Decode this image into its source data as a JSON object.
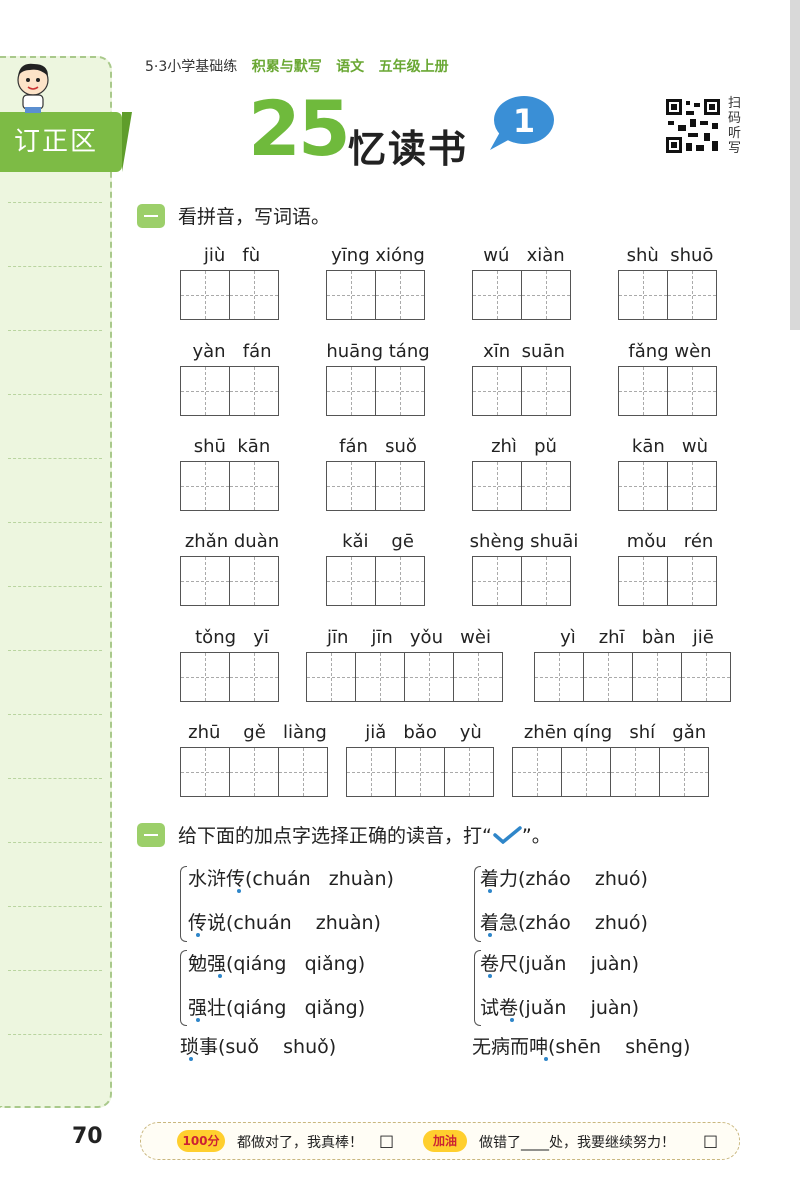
{
  "header": {
    "series": "5·3小学基础练",
    "tag1": "积累与默写",
    "tag2": "语文",
    "tag3": "五年级上册",
    "lesson_number": "25",
    "lesson_title": "忆读书",
    "part_number": "1",
    "qr_label": "扫码听写"
  },
  "sidebar": {
    "title": "订正区"
  },
  "section1": {
    "title": "看拼音，写词语。",
    "groups": [
      {
        "pinyin": "jiù   fù"
      },
      {
        "pinyin": "yīng xióng"
      },
      {
        "pinyin": "wú   xiàn"
      },
      {
        "pinyin": "shù  shuō"
      },
      {
        "pinyin": "yàn   fán"
      },
      {
        "pinyin": "huāng táng"
      },
      {
        "pinyin": "xīn  suān"
      },
      {
        "pinyin": "fǎng wèn"
      },
      {
        "pinyin": "shū  kān"
      },
      {
        "pinyin": "fán   suǒ"
      },
      {
        "pinyin": "zhì   pǔ"
      },
      {
        "pinyin": "kān   wù"
      },
      {
        "pinyin": "zhǎn duàn"
      },
      {
        "pinyin": "kǎi    gē"
      },
      {
        "pinyin": "shèng shuāi"
      },
      {
        "pinyin": "mǒu   rén"
      },
      {
        "pinyin": "tǒng   yī"
      },
      {
        "pinyin": "jīn    jīn   yǒu   wèi"
      },
      {
        "pinyin": "yì    zhī   bàn   jiē"
      },
      {
        "pinyin": "zhū    gě   liàng"
      },
      {
        "pinyin": "jiǎ   bǎo    yù"
      },
      {
        "pinyin": "zhēn qíng   shí   gǎn"
      }
    ]
  },
  "section2": {
    "title": "给下面的加点字选择正确的读音，打“",
    "title_end": "”。",
    "left_items": [
      "水浒传(chuán   zhuàn)",
      "传说(chuán    zhuàn)",
      "勉强(qiáng   qiǎng)",
      "强壮(qiáng   qiǎng)",
      "琐事(suǒ    shuǒ)"
    ],
    "right_items": [
      "着力(zháo    zhuó)",
      "着急(zháo    zhuó)",
      "卷尺(juǎn    juàn)",
      "试卷(juǎn    juàn)",
      "无病而呻(shēn    shēng)"
    ]
  },
  "footer": {
    "page_number": "70",
    "badge1": "100分",
    "text1": "都做对了，我真棒！",
    "badge2": "加油",
    "text2": "做错了____处，我要继续努力！",
    "checkbox": "□"
  },
  "colors": {
    "green": "#6fba3c",
    "blue": "#2f86c9",
    "sidebar": "#edf6df"
  }
}
